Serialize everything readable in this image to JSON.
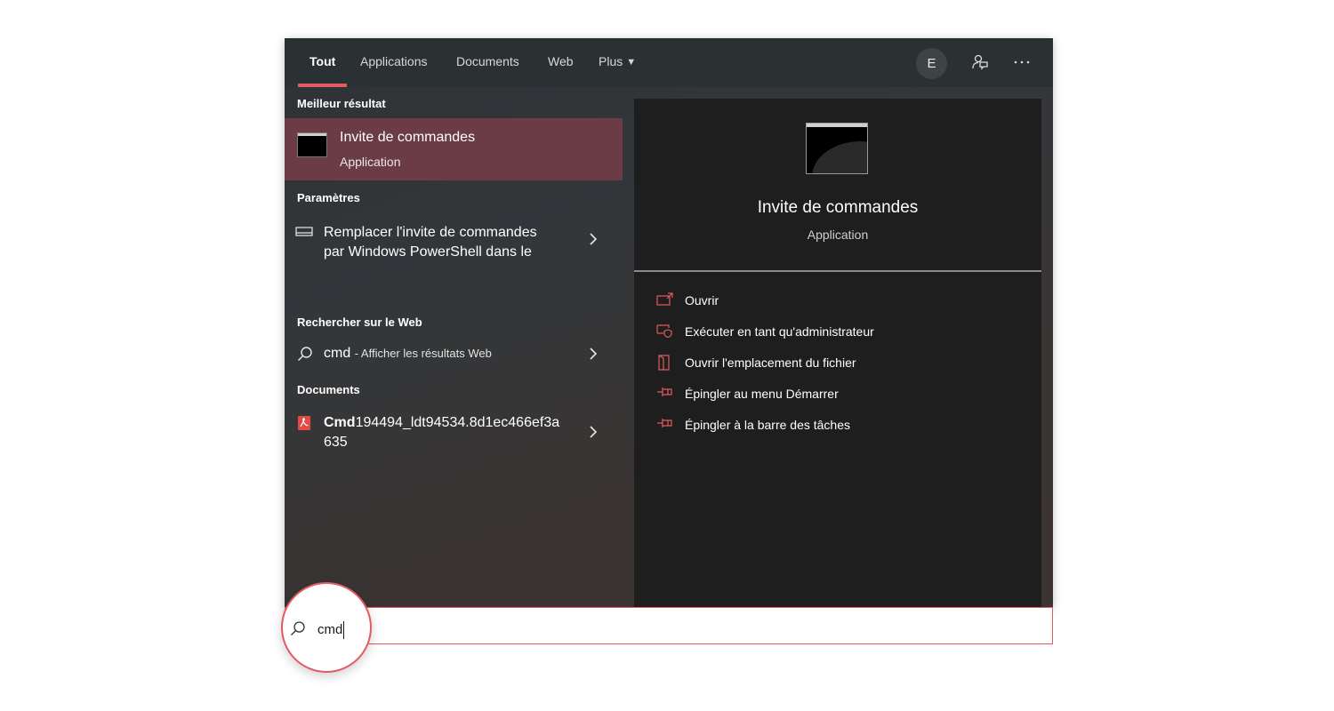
{
  "tabs": [
    {
      "label": "Tout",
      "active": true
    },
    {
      "label": "Applications"
    },
    {
      "label": "Documents"
    },
    {
      "label": "Web"
    },
    {
      "label": "Plus",
      "has_dropdown": true
    }
  ],
  "account": {
    "initial": "E"
  },
  "toolbar_icons": [
    "feedback-icon",
    "more-options-icon"
  ],
  "best_match": {
    "section": "Meilleur résultat",
    "name": "Invite de commandes",
    "kind": "Application",
    "icon": "command-prompt-icon"
  },
  "settings": {
    "section": "Paramètres",
    "item_line1": "Remplacer l'invite de commandes",
    "item_line2": "par Windows PowerShell dans le"
  },
  "web": {
    "section": "Rechercher sur le Web",
    "query": "cmd",
    "suffix": "- Afficher les résultats Web"
  },
  "documents": {
    "section": "Documents",
    "name_bold": "Cmd",
    "name_rest": "194494_ldt94534.8d1ec466ef3a",
    "name_line2": "635"
  },
  "preview": {
    "title": "Invite de commandes",
    "subtitle": "Application",
    "actions": [
      {
        "label": "Ouvrir",
        "icon": "open-icon"
      },
      {
        "label": "Exécuter en tant qu'administrateur",
        "icon": "run-as-admin-icon"
      },
      {
        "label": "Ouvrir l'emplacement du fichier",
        "icon": "file-location-icon"
      },
      {
        "label": "Épingler au menu Démarrer",
        "icon": "pin-icon"
      },
      {
        "label": "Épingler à la barre des tâches",
        "icon": "pin-icon"
      }
    ]
  },
  "search": {
    "value": "cmd"
  },
  "colors": {
    "accent": "#e35a62",
    "selected_row": "#6b3c46",
    "preview_bg": "#1e1e1e"
  }
}
